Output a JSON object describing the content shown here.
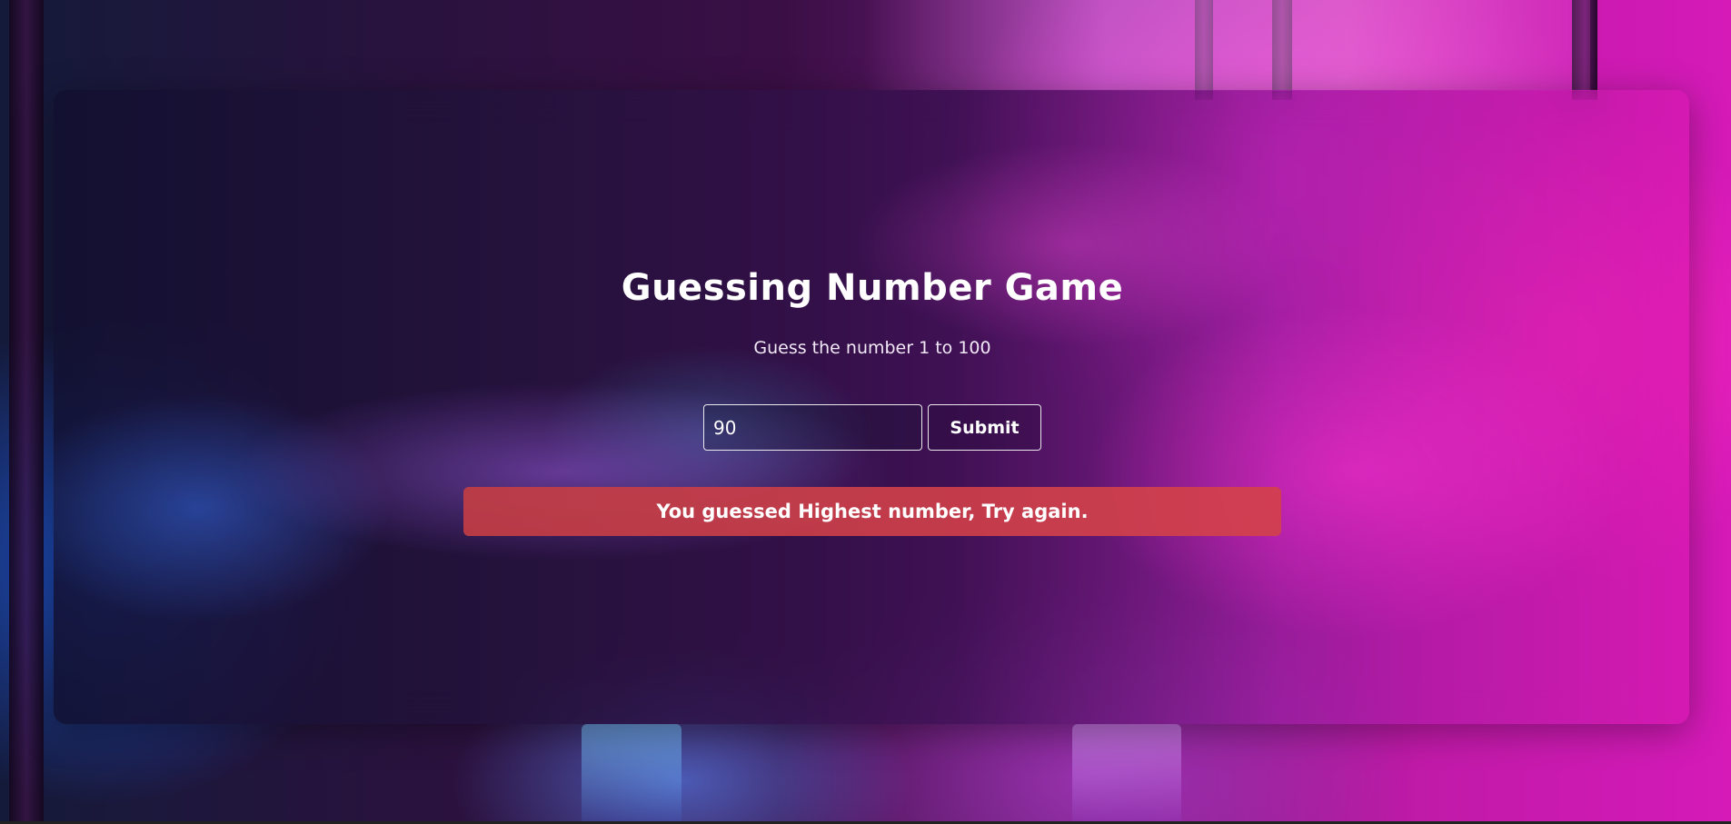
{
  "game": {
    "title": "Guessing Number Game",
    "subtitle": "Guess the number 1 to 100",
    "input": {
      "value": "90",
      "placeholder": ""
    },
    "submit_label": "Submit",
    "feedback_message": "You guessed Highest number, Try again."
  },
  "colors": {
    "alert_background": "#c9414e",
    "text": "#ffffff",
    "accent_pink": "#e01ab8",
    "accent_purple": "#3a0f45"
  }
}
